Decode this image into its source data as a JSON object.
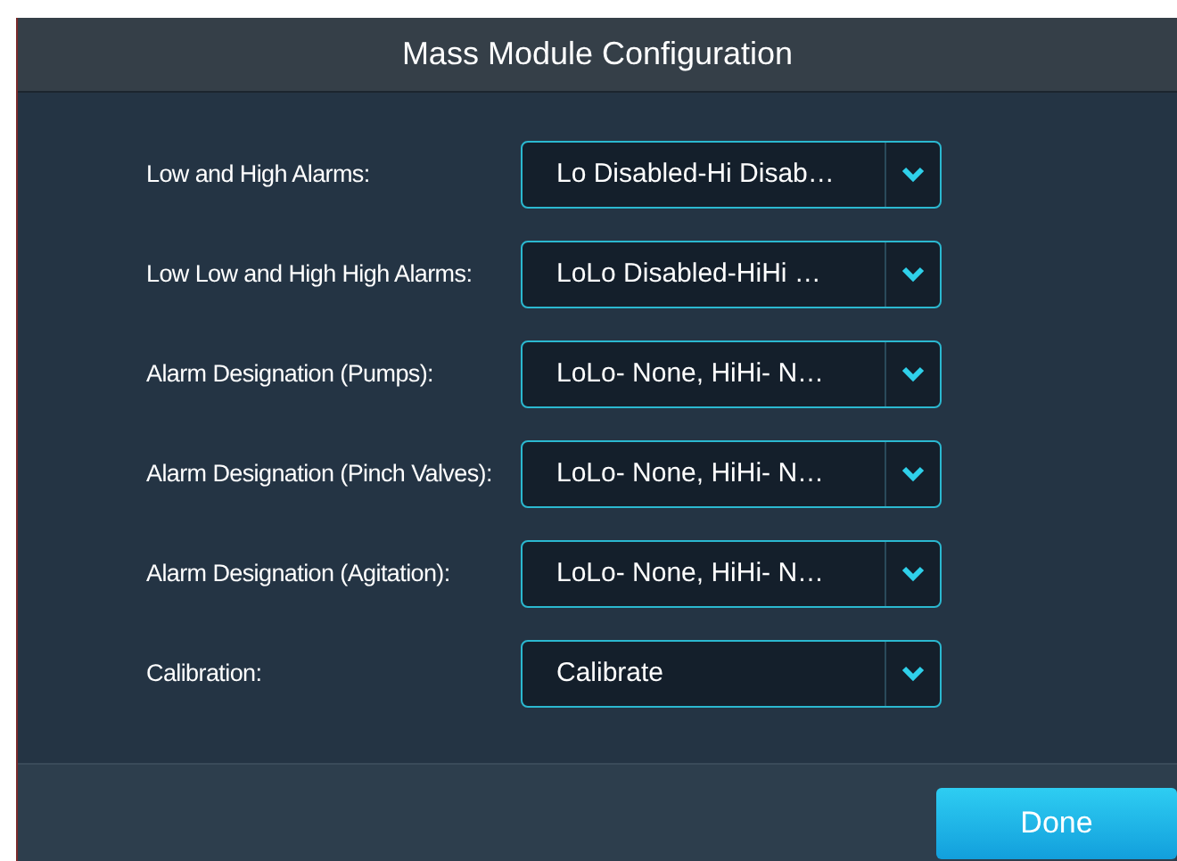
{
  "dialog": {
    "title": "Mass Module Configuration"
  },
  "settings": [
    {
      "label": "Low and High Alarms:",
      "value": "Lo Disabled-Hi Disab…"
    },
    {
      "label": "Low Low and High High Alarms:",
      "value": "LoLo Disabled-HiHi …"
    },
    {
      "label": "Alarm Designation (Pumps):",
      "value": "LoLo- None, HiHi- N…"
    },
    {
      "label": "Alarm Designation (Pinch Valves):",
      "value": "LoLo- None, HiHi- N…"
    },
    {
      "label": "Alarm Designation (Agitation):",
      "value": "LoLo- None, HiHi- N…"
    },
    {
      "label": "Calibration:",
      "value": "Calibrate"
    }
  ],
  "buttons": [
    "Done"
  ]
}
